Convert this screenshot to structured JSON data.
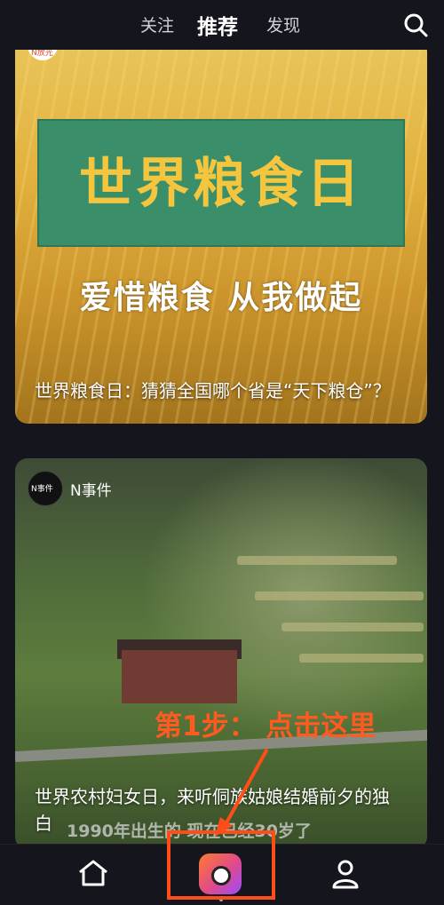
{
  "header": {
    "tabs": [
      "关注",
      "推荐",
      "发现"
    ],
    "active_tab": "推荐"
  },
  "feed": [
    {
      "banner_title": "世界粮食日",
      "banner_subtitle": "爱惜粮食 从我做起",
      "caption": "世界粮食日：猜猜全国哪个省是“天下粮仓”？",
      "avatar_text": "N放光"
    },
    {
      "account": "N事件",
      "avatar_text": "N事件",
      "caption": "世界农村妇女日，来听侗族姑娘结婚前夕的独白",
      "overlay_subtitle": "1990年出生的 现在已经30岁了"
    }
  ],
  "annotation": {
    "step_text": "第1步：  点击这里",
    "accent_color": "#ff4d1a"
  },
  "bottom_nav": {
    "items": [
      "home-icon",
      "camera-icon",
      "profile-icon"
    ]
  },
  "colors": {
    "background": "#15151d",
    "banner_green": "#3a8f6a",
    "banner_text": "#f5c63d"
  }
}
